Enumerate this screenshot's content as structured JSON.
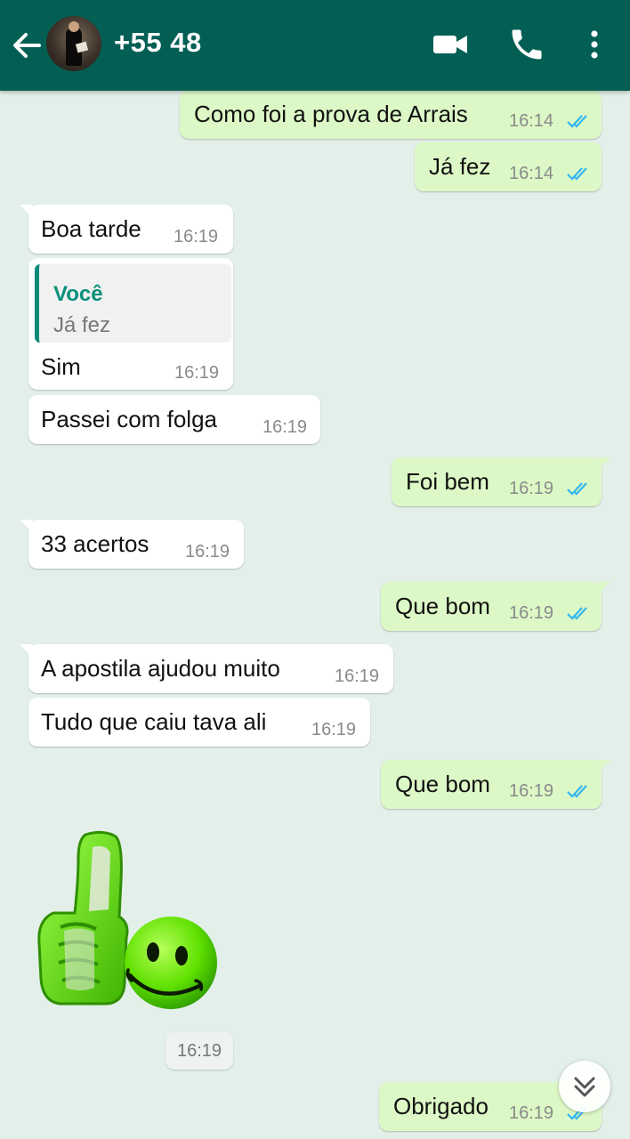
{
  "header": {
    "title": "+55 48",
    "icons": [
      "back-arrow-icon",
      "video-call-icon",
      "phone-icon",
      "more-options-icon"
    ]
  },
  "messages": [
    {
      "dir": "out",
      "text": "Como foi a prova de Arrais",
      "time": "16:14",
      "status": "read"
    },
    {
      "dir": "out",
      "text": "Já fez",
      "time": "16:14",
      "status": "read"
    },
    {
      "dir": "in",
      "text": "Boa tarde",
      "time": "16:19"
    },
    {
      "dir": "in",
      "quote_author": "Você",
      "quote_text": "Já fez",
      "text": "Sim",
      "time": "16:19"
    },
    {
      "dir": "in",
      "text": "Passei com folga",
      "time": "16:19"
    },
    {
      "dir": "out",
      "text": "Foi bem",
      "time": "16:19",
      "status": "read"
    },
    {
      "dir": "in",
      "text": "33 acertos",
      "time": "16:19"
    },
    {
      "dir": "out",
      "text": "Que bom",
      "time": "16:19",
      "status": "read"
    },
    {
      "dir": "in",
      "text": "A apostila ajudou muito",
      "time": "16:19"
    },
    {
      "dir": "in",
      "text": "Tudo que caiu tava ali",
      "time": "16:19"
    },
    {
      "dir": "out",
      "text": "Que bom",
      "time": "16:19",
      "status": "read"
    },
    {
      "dir": "in",
      "type": "sticker",
      "sticker": "thumbs-up-smiley-sticker",
      "time": "16:19"
    },
    {
      "dir": "out",
      "text": "Obrigado",
      "time": "16:19",
      "status": "read"
    }
  ],
  "colors": {
    "header": "#035f54",
    "background": "#e3efe9",
    "outgoing_bubble": "#dcf8c6",
    "incoming_bubble": "#ffffff",
    "read_ticks": "#34b7f1",
    "quote_accent": "#07907c"
  }
}
